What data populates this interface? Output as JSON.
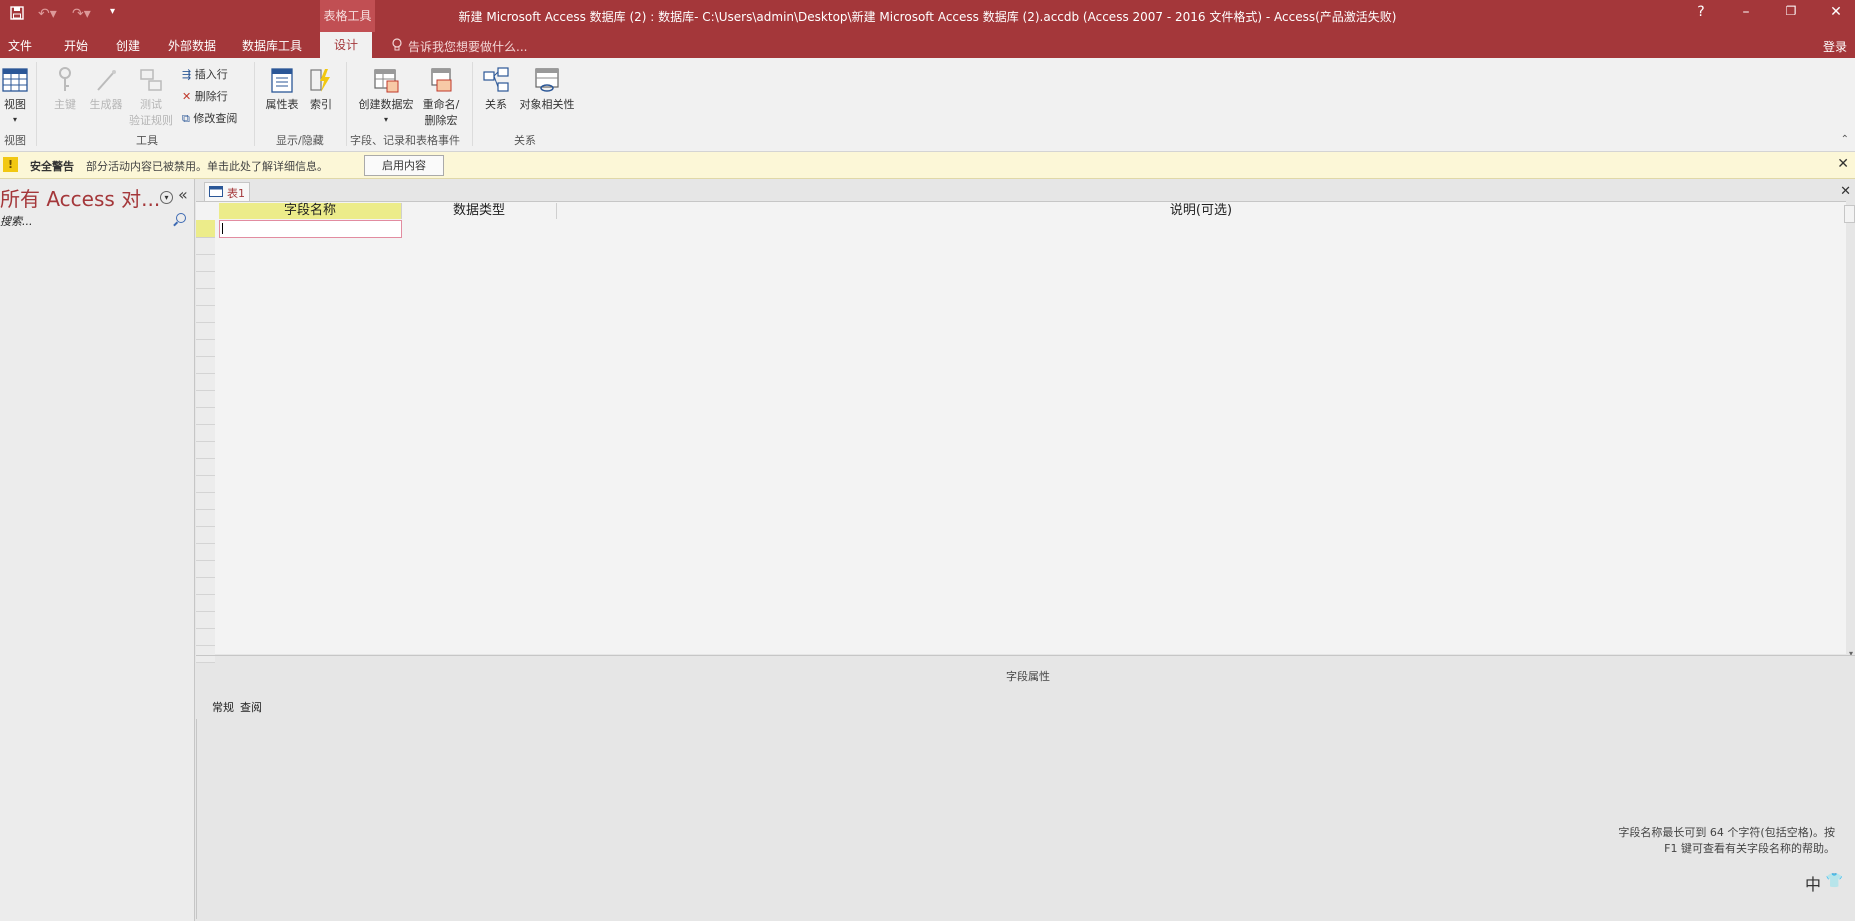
{
  "title_bar": {
    "context_tab": "表格工具",
    "title": "新建 Microsoft Access 数据库 (2) : 数据库- C:\\Users\\admin\\Desktop\\新建 Microsoft Access 数据库 (2).accdb (Access 2007 - 2016 文件格式) - Access(产品激活失败)",
    "help": "?",
    "minimize": "–",
    "restore": "❐",
    "close": "✕"
  },
  "tabs": [
    "文件",
    "开始",
    "创建",
    "外部数据",
    "数据库工具",
    "设计"
  ],
  "tell_me": "告诉我您想要做什么...",
  "login": "登录",
  "ribbon": {
    "view": "视图",
    "primary_key": "主键",
    "builder": "生成器",
    "test_line1": "测试",
    "test_line2": "验证规则",
    "insert_rows": "插入行",
    "delete_rows": "删除行",
    "modify_lookups": "修改查阅",
    "property_sheet": "属性表",
    "indexes": "索引",
    "create_macro": "创建数据宏",
    "rename_line1": "重命名/",
    "rename_line2": "删除宏",
    "relationships": "关系",
    "object_dependencies": "对象相关性",
    "groups": {
      "view": "视图",
      "tools": "工具",
      "show_hide": "显示/隐藏",
      "field_events": "字段、记录和表格事件",
      "relationships": "关系"
    }
  },
  "security": {
    "title": "安全警告",
    "message": "部分活动内容已被禁用。单击此处了解详细信息。",
    "button": "启用内容"
  },
  "nav": {
    "title": "所有 Access 对...",
    "collapse": "«",
    "search_placeholder": "搜索..."
  },
  "doc": {
    "tab_label": "表1",
    "columns": [
      "字段名称",
      "数据类型",
      "说明(可选)"
    ],
    "field_properties": "字段属性",
    "prop_tabs": [
      "常规",
      "查阅"
    ],
    "help_text_line1": "字段名称最长可到 64 个字符(包括空格)。按",
    "help_text_line2": "F1 键可查看有关字段名称的帮助。"
  },
  "ime": "中",
  "colors": {
    "accent": "#a4373a",
    "warning": "#f2c811"
  }
}
